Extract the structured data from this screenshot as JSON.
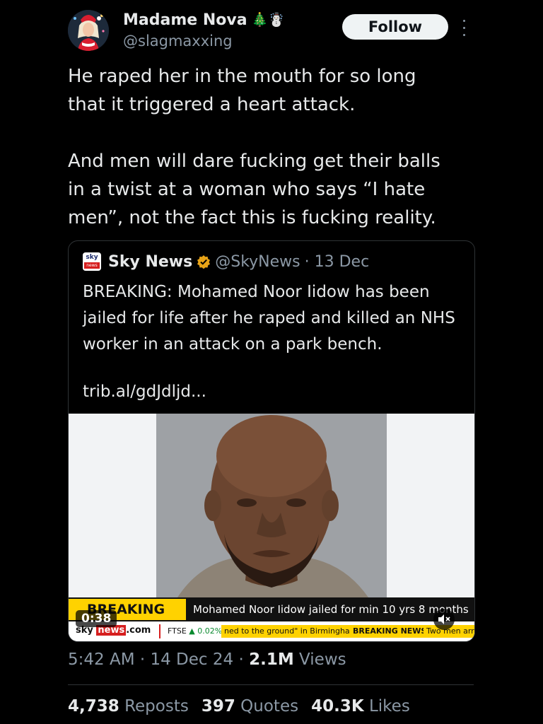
{
  "author": {
    "display_name": "Madame Nova",
    "emoji": "🎄☃️",
    "handle": "@slagmaxxing",
    "follow_label": "Follow"
  },
  "tweet": {
    "text": "He raped her in the mouth for so long\nthat it triggered a heart attack.\n\nAnd men will dare fucking get their balls\nin a twist at a woman who says “I hate\nmen”, not the fact this is fucking reality."
  },
  "quoted": {
    "logo_text": "sky",
    "logo_sub": "news",
    "display_name": "Sky News",
    "handle": "@SkyNews",
    "date": "· 13 Dec",
    "text": "BREAKING: Mohamed Noor Iidow has been jailed for life after he raped and killed an NHS worker in an attack on a park bench.",
    "link": "trib.al/gdJdljd...",
    "media": {
      "breaking_label": "BREAKING NEWS",
      "headline": "Mohamed Noor Iidow jailed for min 10 yrs 8 months",
      "site_prefix": "sky",
      "site_news": "news",
      "site_suffix": ".com",
      "ftse_label": "FTSE",
      "ftse_change": "▲ 0.02%",
      "marquee": "ned to the ground\" in Birmingham",
      "breaking_small": "BREAKING NEWS",
      "two_men": "Two men arr",
      "timer": "0:38"
    },
    "verified_color": "#e8a317",
    "accent_red": "#d61e1e",
    "accent_yellow": "#ffd200"
  },
  "meta": {
    "time": "5:42 AM",
    "date": "14 Dec 24",
    "views_count": "2.1M",
    "views_label": "Views"
  },
  "stats": {
    "reposts_count": "4,738",
    "reposts_label": "Reposts",
    "quotes_count": "397",
    "quotes_label": "Quotes",
    "likes_count": "40.3K",
    "likes_label": "Likes"
  }
}
